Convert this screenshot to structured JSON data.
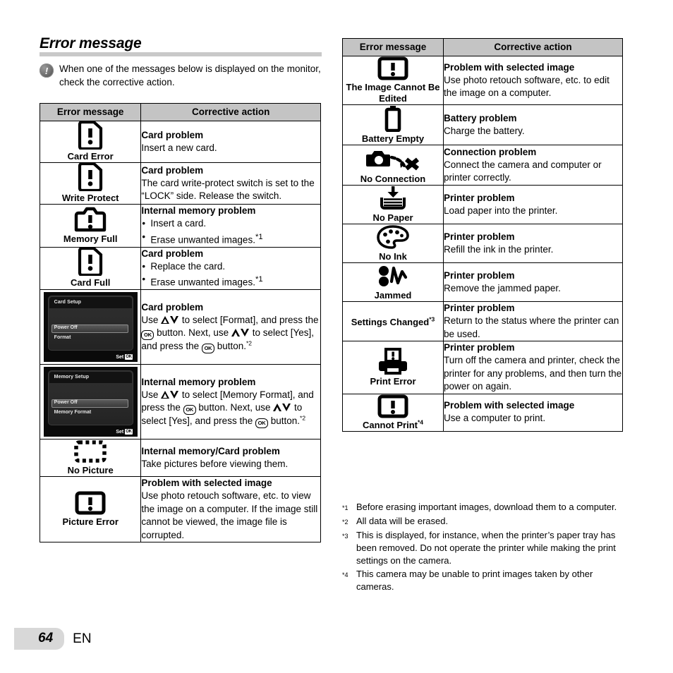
{
  "section": {
    "title": "Error message",
    "note_icon": "info-exclamation-icon",
    "note": "When one of the messages below is displayed on the monitor, check the corrective action."
  },
  "table_headers": {
    "message": "Error message",
    "action": "Corrective action"
  },
  "left_table": [
    {
      "icon": "sd-card-error-icon",
      "label": "Card Error",
      "action_head": "Card problem",
      "action_body": "Insert a new card."
    },
    {
      "icon": "sd-card-error-icon",
      "label": "Write Protect",
      "action_head": "Card problem",
      "action_body": "The card write-protect switch is set to the “LOCK” side. Release the switch."
    },
    {
      "icon": "camera-memory-full-icon",
      "label": "Memory Full",
      "action_head": "Internal memory problem",
      "bullets": [
        "Insert a card.",
        "Erase unwanted images."
      ],
      "bullet_marks": [
        "",
        "*1"
      ]
    },
    {
      "icon": "sd-card-error-icon",
      "label": "Card Full",
      "action_head": "Card problem",
      "bullets": [
        "Replace the card.",
        "Erase unwanted images."
      ],
      "bullet_marks": [
        "",
        "*1"
      ]
    },
    {
      "icon": "lcd-screenshot-card-setup",
      "lcd": {
        "title": "Card Setup",
        "item1": "Power Off",
        "item2": "Format",
        "set_label": "Set",
        "ok_label": "OK"
      },
      "action_head": "Card problem",
      "action_rich": "use-format-instructions",
      "footnote_mark": "*2"
    },
    {
      "icon": "lcd-screenshot-memory-setup",
      "lcd": {
        "title": "Memory Setup",
        "item1": "Power Off",
        "item2": "Memory Format",
        "set_label": "Set",
        "ok_label": "OK"
      },
      "action_head": "Internal memory problem",
      "action_rich": "use-memory-format-instructions",
      "footnote_mark": "*2"
    },
    {
      "icon": "no-picture-dashed-frame-icon",
      "label": "No Picture",
      "action_head": "Internal memory/Card problem",
      "action_body": "Take pictures before viewing them."
    },
    {
      "icon": "picture-error-icon",
      "label": "Picture Error",
      "action_head": "Problem with selected image",
      "action_body": "Use photo retouch software, etc. to view the image on a computer. If the image still cannot be viewed, the image file is corrupted."
    }
  ],
  "right_table": [
    {
      "icon": "image-cannot-be-edited-icon",
      "label": "The Image Cannot Be Edited",
      "action_head": "Problem with selected image",
      "action_body": "Use photo retouch software, etc. to edit the image on a computer."
    },
    {
      "icon": "battery-empty-icon",
      "label": "Battery Empty",
      "action_head": "Battery problem",
      "action_body": "Charge the battery."
    },
    {
      "icon": "no-connection-icon",
      "label": "No Connection",
      "action_head": "Connection problem",
      "action_body": "Connect the camera and computer or printer correctly."
    },
    {
      "icon": "no-paper-icon",
      "label": "No Paper",
      "action_head": "Printer problem",
      "action_body": "Load paper into the printer."
    },
    {
      "icon": "no-ink-palette-icon",
      "label": "No Ink",
      "action_head": "Printer problem",
      "action_body": "Refill the ink in the printer."
    },
    {
      "icon": "jammed-icon",
      "label": "Jammed",
      "action_head": "Printer problem",
      "action_body": "Remove the jammed paper."
    },
    {
      "icon": "none",
      "label": "Settings Changed",
      "label_sup": "*3",
      "action_head": "Printer problem",
      "action_body": "Return to the status where the printer can be used."
    },
    {
      "icon": "print-error-icon",
      "label": "Print Error",
      "action_head": "Printer problem",
      "action_body": "Turn off the camera and printer, check the printer for any problems, and then turn the power on again."
    },
    {
      "icon": "cannot-print-icon",
      "label": "Cannot Print",
      "label_sup": "*4",
      "action_head": "Problem with selected image",
      "action_body": "Use a computer to print."
    }
  ],
  "lcd_instructions": {
    "card": {
      "p1": "Use",
      "p2": "to select [Format], and press the",
      "p3": "button. Next, use",
      "p4": "to select [Yes], and press the",
      "p5": "button.",
      "sup": "*2",
      "ok": "OK"
    },
    "memory": {
      "p1": "Use",
      "p2": "to select [Memory Format], and press the",
      "p3": "button. Next, use",
      "p4": "to select [Yes], and press the",
      "p5": "button.",
      "sup": "*2",
      "ok": "OK"
    }
  },
  "footnotes": [
    {
      "mark": "*1",
      "text": "Before erasing important images, download them to a computer."
    },
    {
      "mark": "*2",
      "text": "All data will be erased."
    },
    {
      "mark": "*3",
      "text": "This is displayed, for instance, when the printer’s paper tray has been removed. Do not operate the printer while making the print settings on the camera."
    },
    {
      "mark": "*4",
      "text": "This camera may be unable to print images taken by other cameras."
    }
  ],
  "footer": {
    "page_number": "64",
    "language": "EN"
  },
  "colors": {
    "header_bg": "#c4c4c4",
    "rule": "#c9c9c9",
    "page_badge": "#d8d8d8",
    "text": "#000000"
  }
}
